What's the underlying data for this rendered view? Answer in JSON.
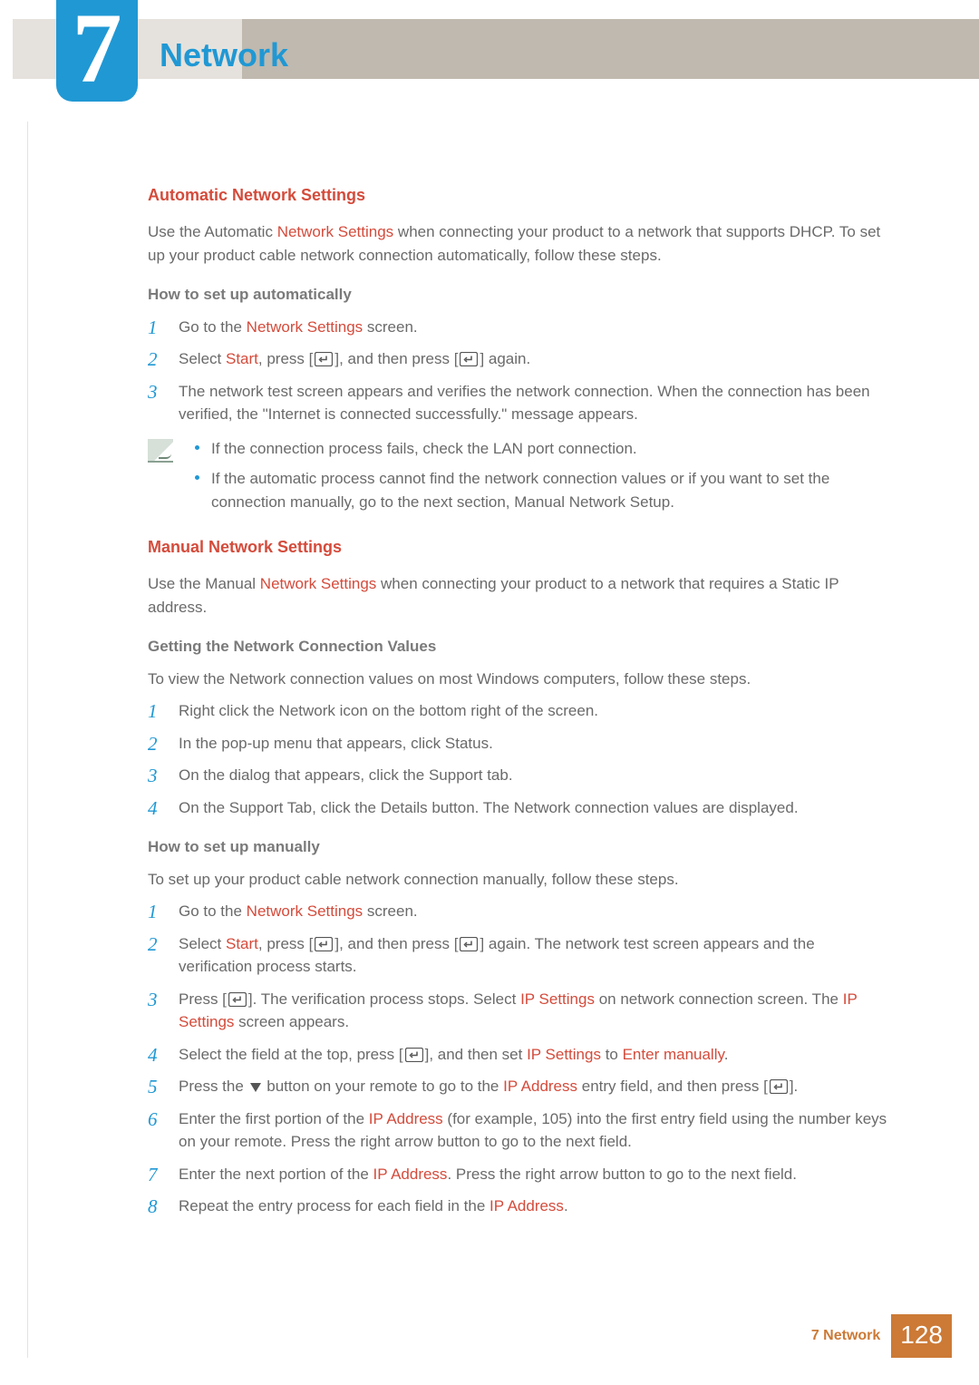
{
  "chapter": {
    "number": "7",
    "title": "Network"
  },
  "sections": {
    "auto": {
      "heading": "Automatic Network Settings",
      "intro_pre": "Use the Automatic ",
      "intro_kw": "Network Settings",
      "intro_post": " when connecting your product to a network that supports DHCP. To set up your product cable network connection automatically, follow these steps.",
      "sub_heading": "How to set up automatically",
      "steps": {
        "s1_pre": "Go to the ",
        "s1_kw": "Network Settings",
        "s1_post": " screen.",
        "s2_pre": "Select ",
        "s2_kw": "Start",
        "s2_mid": ", press [",
        "s2_mid2": "], and then press [",
        "s2_post": "] again.",
        "s3": "The network test screen appears and verifies the network connection. When the connection has been verified, the \"Internet is connected successfully.\" message appears."
      },
      "notes": {
        "n1": "If the connection process fails, check the LAN port connection.",
        "n2": "If the automatic process cannot find the network connection values or if you want to set the connection manually, go to the next section, Manual Network Setup."
      }
    },
    "manual": {
      "heading": "Manual Network Settings",
      "intro_pre": "Use the Manual ",
      "intro_kw": "Network Settings",
      "intro_post": " when connecting your product to a network that requires a Static IP address.",
      "values_heading": "Getting the Network Connection Values",
      "values_intro": "To view the Network connection values on most Windows computers, follow these steps.",
      "values_steps": {
        "v1": "Right click the Network icon on the bottom right of the screen.",
        "v2": "In the pop-up menu that appears, click Status.",
        "v3": "On the dialog that appears, click the Support tab.",
        "v4": "On the Support Tab, click the Details button. The Network connection values are displayed."
      },
      "setup_heading": "How to set up manually",
      "setup_intro": "To set up your product cable network connection manually, follow these steps.",
      "setup_steps": {
        "m1_pre": "Go to the ",
        "m1_kw": "Network Settings",
        "m1_post": " screen.",
        "m2_pre": "Select ",
        "m2_kw": "Start",
        "m2_mid": ", press [",
        "m2_mid2": "], and then press [",
        "m2_post": "] again. The network test screen appears and the verification process starts.",
        "m3_pre": "Press [",
        "m3_mid": "]. The verification process stops. Select ",
        "m3_kw1": "IP Settings",
        "m3_mid2": " on network connection screen. The ",
        "m3_kw2": "IP Settings",
        "m3_post": " screen appears.",
        "m4_pre": "Select the field at the top, press [",
        "m4_mid": "], and then set ",
        "m4_kw1": "IP Settings",
        "m4_mid2": " to ",
        "m4_kw2": "Enter manually",
        "m4_post": ".",
        "m5_pre": "Press the ",
        "m5_mid": " button on your remote to go to the ",
        "m5_kw": "IP Address",
        "m5_mid2": " entry field, and then press [",
        "m5_post": "].",
        "m6_pre": "Enter the first portion of the ",
        "m6_kw": "IP Address",
        "m6_post": " (for example, 105) into the first entry field using the number keys on your remote. Press the right arrow button to go to the next field.",
        "m7_pre": "Enter the next portion of the ",
        "m7_kw": "IP Address",
        "m7_post": ". Press the right arrow button to go to the next field.",
        "m8_pre": "Repeat the entry process for each field in the ",
        "m8_kw": "IP Address",
        "m8_post": "."
      }
    }
  },
  "footer": {
    "label": "7 Network",
    "page": "128"
  }
}
